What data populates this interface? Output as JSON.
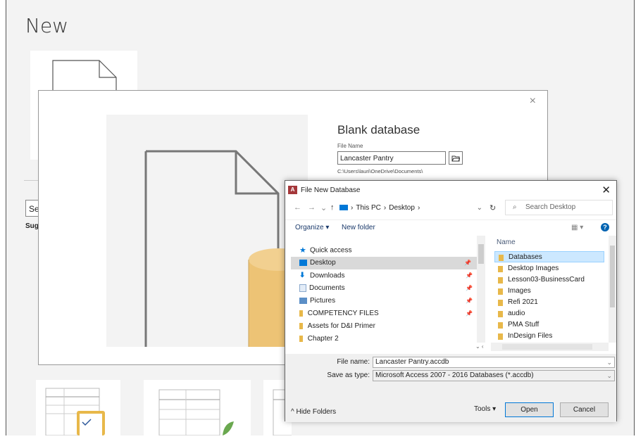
{
  "backstage": {
    "title": "New",
    "search_partial": "Sear",
    "suggested_partial": "Sugge"
  },
  "blank_panel": {
    "close": "×",
    "title": "Blank database",
    "file_name_label": "File Name",
    "file_name_value": "Lancaster Pantry",
    "path": "C:\\Users\\lauri\\OneDrive\\Documents\\"
  },
  "dialog": {
    "app_icon": "A",
    "title": "File New Database",
    "close": "✕",
    "address": {
      "root": "This PC",
      "folder": "Desktop"
    },
    "search_placeholder": "Search Desktop",
    "toolbar": {
      "organize": "Organize ▾",
      "new_folder": "New folder"
    },
    "nav": [
      {
        "label": "Quick access",
        "icon": "star-icon",
        "pinned": false
      },
      {
        "label": "Desktop",
        "icon": "desktop-icon",
        "pinned": true,
        "selected": true
      },
      {
        "label": "Downloads",
        "icon": "download-icon",
        "pinned": true
      },
      {
        "label": "Documents",
        "icon": "documents-icon",
        "pinned": true
      },
      {
        "label": "Pictures",
        "icon": "pictures-icon",
        "pinned": true
      },
      {
        "label": "COMPETENCY FILES",
        "icon": "folder-icon",
        "pinned": true
      },
      {
        "label": "Assets for D&I Primer",
        "icon": "folder-icon",
        "pinned": false
      },
      {
        "label": "Chapter 2",
        "icon": "folder-icon",
        "pinned": false
      }
    ],
    "column_name": "Name",
    "files": [
      "Databases",
      "Desktop Images",
      "Lesson03-BusinessCard",
      "Images",
      "Refi 2021",
      "audio",
      "PMA Stuff",
      "InDesign Files"
    ],
    "file_name_label": "File name:",
    "file_name_value": "Lancaster Pantry.accdb",
    "save_type_label": "Save as type:",
    "save_type_value": "Microsoft Access 2007 - 2016 Databases (*.accdb)",
    "hide_folders": "Hide Folders",
    "tools": "Tools",
    "open": "Open",
    "cancel": "Cancel"
  },
  "colors": {
    "folder": "#e8b84a",
    "access_red": "#a4373a",
    "selection": "#cce8ff",
    "accent": "#0078d7"
  }
}
